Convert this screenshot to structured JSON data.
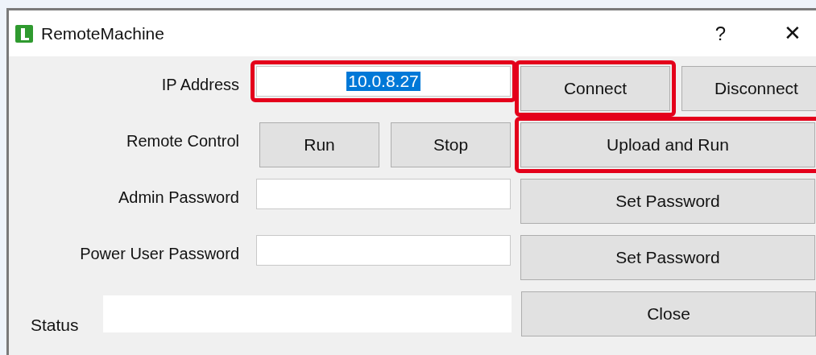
{
  "window": {
    "title": "RemoteMachine",
    "help": "?",
    "close": "✕"
  },
  "rows": [
    {
      "kind": "ip",
      "label": "IP Address",
      "field": {
        "value": "10.0.8.27",
        "text_selected": true,
        "highlighted": true
      },
      "buttons": [
        {
          "label": "Connect",
          "highlighted": true
        },
        {
          "label": "Disconnect",
          "highlighted": false
        }
      ]
    },
    {
      "kind": "control",
      "label": "Remote Control",
      "small_buttons": [
        {
          "label": "Run"
        },
        {
          "label": "Stop"
        }
      ],
      "buttons": [
        {
          "label": "Upload and Run",
          "highlighted": true
        }
      ]
    },
    {
      "kind": "password",
      "label": "Admin Password",
      "field": {
        "highlighted": false
      },
      "buttons": [
        {
          "label": "Set Password",
          "highlighted": false
        }
      ]
    },
    {
      "kind": "password",
      "label": "Power User Password",
      "field": {
        "highlighted": false
      },
      "buttons": [
        {
          "label": "Set Password",
          "highlighted": false
        }
      ]
    },
    {
      "kind": "status",
      "label": "Status",
      "buttons": [
        {
          "label": "Close",
          "highlighted": false
        }
      ]
    }
  ]
}
